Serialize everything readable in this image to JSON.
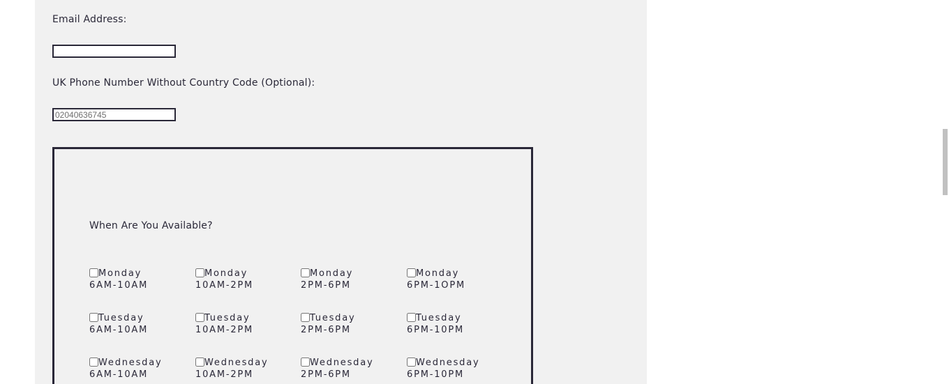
{
  "form": {
    "email_label": "Email Address:",
    "email_value": "",
    "phone_label": "UK Phone Number Without Country Code (Optional):",
    "phone_placeholder": "02040636745",
    "availability_title": "When Are You Available?"
  },
  "availability": [
    [
      {
        "day": "Monday",
        "time": "6AM-10AM",
        "checked": false
      },
      {
        "day": "Monday",
        "time": "10AM-2PM",
        "checked": false
      },
      {
        "day": "Monday",
        "time": "2PM-6PM",
        "checked": false
      },
      {
        "day": "Monday",
        "time": "6PM-1OPM",
        "checked": false
      }
    ],
    [
      {
        "day": "Tuesday",
        "time": "6AM-10AM",
        "checked": false
      },
      {
        "day": "Tuesday",
        "time": "10AM-2PM",
        "checked": false
      },
      {
        "day": "Tuesday",
        "time": "2PM-6PM",
        "checked": false
      },
      {
        "day": "Tuesday",
        "time": "6PM-10PM",
        "checked": false
      }
    ],
    [
      {
        "day": "Wednesday",
        "time": "6AM-10AM",
        "checked": false
      },
      {
        "day": "Wednesday",
        "time": "10AM-2PM",
        "checked": false
      },
      {
        "day": "Wednesday",
        "time": "2PM-6PM",
        "checked": false
      },
      {
        "day": "Wednesday",
        "time": "6PM-10PM",
        "checked": false
      }
    ]
  ]
}
